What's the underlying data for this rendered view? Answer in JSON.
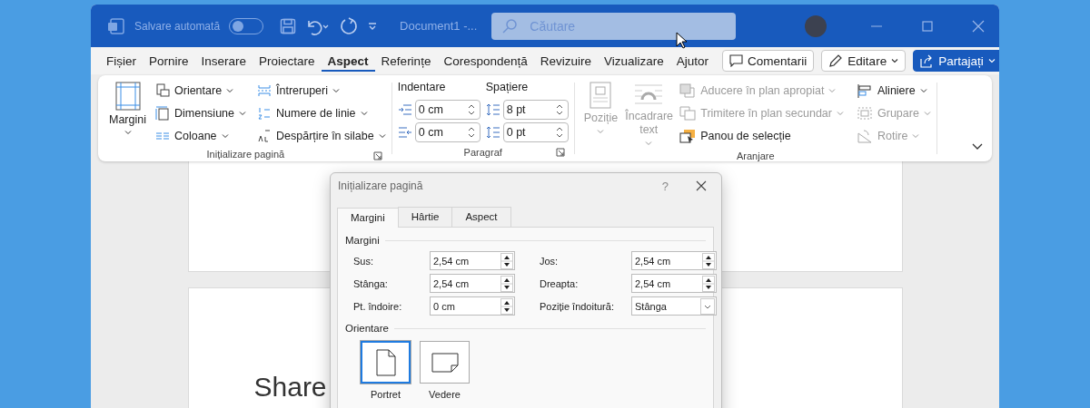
{
  "title_bar": {
    "autosave_label": "Salvare automată",
    "autosave_on": false,
    "document_title": "Document1 -...",
    "search_placeholder": "Căutare"
  },
  "menu_tabs": [
    {
      "label": "Fișier",
      "selected": false
    },
    {
      "label": "Pornire",
      "selected": false
    },
    {
      "label": "Inserare",
      "selected": false
    },
    {
      "label": "Proiectare",
      "selected": false
    },
    {
      "label": "Aspect",
      "selected": true
    },
    {
      "label": "Referințe",
      "selected": false
    },
    {
      "label": "Corespondență",
      "selected": false
    },
    {
      "label": "Revizuire",
      "selected": false
    },
    {
      "label": "Vizualizare",
      "selected": false
    },
    {
      "label": "Ajutor",
      "selected": false
    }
  ],
  "action_buttons": [
    {
      "kind": "comments",
      "label": "Comentarii"
    },
    {
      "kind": "editing",
      "label": "Editare"
    },
    {
      "kind": "share",
      "label": "Partajați"
    }
  ],
  "ribbon": {
    "page_setup": {
      "title": "Inițializare pagină",
      "big_button": "Margini",
      "items": [
        {
          "kind": "orientation",
          "label": "Orientare"
        },
        {
          "kind": "size",
          "label": "Dimensiune"
        },
        {
          "kind": "columns",
          "label": "Coloane"
        },
        {
          "kind": "breaks",
          "label": "Întreruperi"
        },
        {
          "kind": "line_numbers",
          "label": "Numere de linie"
        },
        {
          "kind": "hyphenation",
          "label": "Despărțire în silabe"
        }
      ]
    },
    "paragraph": {
      "title": "Paragraf",
      "indent_label": "Indentare",
      "spacing_label": "Spațiere",
      "indent_left": "0 cm",
      "indent_right": "0 cm",
      "spacing_before": "8 pt",
      "spacing_after": "0 pt"
    },
    "arrange": {
      "title": "Aranjare",
      "big_buttons": [
        {
          "kind": "position",
          "label": "Poziție",
          "disabled": true
        },
        {
          "kind": "wrap",
          "label": "Încadrare text",
          "disabled": true
        }
      ],
      "items": [
        {
          "kind": "forward",
          "label": "Aducere în plan apropiat",
          "disabled": true
        },
        {
          "kind": "backward",
          "label": "Trimitere în plan secundar",
          "disabled": true
        },
        {
          "kind": "selection",
          "label": "Panou de selecție",
          "disabled": false
        },
        {
          "kind": "align",
          "label": "Aliniere",
          "disabled": false
        },
        {
          "kind": "group",
          "label": "Grupare",
          "disabled": true
        },
        {
          "kind": "rotate",
          "label": "Rotire",
          "disabled": true
        }
      ]
    }
  },
  "document": {
    "page_text": "Share"
  },
  "dialog": {
    "title": "Inițializare pagină",
    "help": "?",
    "tabs": [
      {
        "label": "Margini",
        "selected": true
      },
      {
        "label": "Hârtie",
        "selected": false
      },
      {
        "label": "Aspect",
        "selected": false
      }
    ],
    "margins_heading": "Margini",
    "fields": [
      {
        "kind": "spin",
        "label": "Sus:",
        "value": "2,54 cm"
      },
      {
        "kind": "spin",
        "label": "Jos:",
        "value": "2,54 cm"
      },
      {
        "kind": "spin",
        "label": "Stânga:",
        "value": "2,54 cm"
      },
      {
        "kind": "spin",
        "label": "Dreapta:",
        "value": "2,54 cm"
      },
      {
        "kind": "spin",
        "label": "Pt. îndoire:",
        "value": "0 cm"
      },
      {
        "kind": "select",
        "label": "Poziție îndoitură:",
        "value": "Stânga"
      }
    ],
    "orientation_heading": "Orientare",
    "orientations": [
      {
        "kind": "portrait",
        "label": "Portret",
        "selected": true
      },
      {
        "kind": "landscape",
        "label": "Vedere",
        "selected": false
      }
    ]
  }
}
